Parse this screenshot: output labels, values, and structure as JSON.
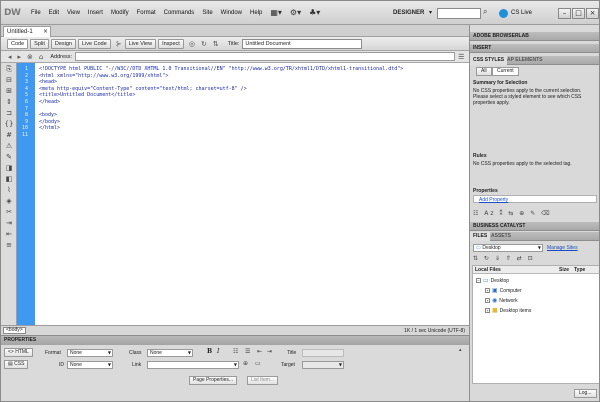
{
  "app": {
    "logo": "DW",
    "workspace": "DESIGNER",
    "cs_live": "CS Live"
  },
  "menu": [
    "File",
    "Edit",
    "View",
    "Insert",
    "Modify",
    "Format",
    "Commands",
    "Site",
    "Window",
    "Help"
  ],
  "document": {
    "tab_name": "Untitled-1",
    "view_buttons": {
      "code": "Code",
      "split": "Split",
      "design": "Design",
      "live_code": "Live Code",
      "live_view": "Live View",
      "inspect": "Inspect"
    },
    "title_label": "Title:",
    "title_value": "Untitled Document",
    "address_label": "Address:"
  },
  "code": {
    "line_numbers": [
      "1",
      "2",
      "3",
      "4",
      "5",
      "6",
      "7",
      "8",
      "9",
      "10",
      "11"
    ],
    "lines": [
      "<!DOCTYPE html PUBLIC \"-//W3C//DTD XHTML 1.0 Transitional//EN\" \"http://www.w3.org/TR/xhtml1/DTD/xhtml1-transitional.dtd\">",
      "<html xmlns=\"http://www.w3.org/1999/xhtml\">",
      "<head>",
      "<meta http-equiv=\"Content-Type\" content=\"text/html; charset=utf-8\" />",
      "<title>Untitled Document</title>",
      "</head>",
      "",
      "<body>",
      "</body>",
      "</html>",
      ""
    ]
  },
  "status": {
    "tag_selector": "<body>",
    "info": "1K / 1 sec  Unicode (UTF-8)"
  },
  "properties": {
    "header": "PROPERTIES",
    "html_button": "HTML",
    "css_button": "CSS",
    "format_label": "Format",
    "format_value": "None",
    "class_label": "Class",
    "class_value": "None",
    "id_label": "ID",
    "id_value": "None",
    "link_label": "Link",
    "title_label": "Title",
    "target_label": "Target",
    "page_properties_button": "Page Properties...",
    "list_item_button": "List Item..."
  },
  "right_panels": {
    "browserlab": "ADOBE BROWSERLAB",
    "insert": "INSERT",
    "css_styles_tab": "CSS STYLES",
    "ap_elements_tab": "AP ELEMENTS",
    "all_button": "All",
    "current_button": "Current",
    "summary_title": "Summary for Selection",
    "summary_text": [
      "No CSS properties apply to the current selection.",
      "Please select a styled element to see which CSS",
      "properties apply."
    ],
    "rules_title": "Rules",
    "rules_text": "No CSS properties apply to the selected tag.",
    "properties_title": "Properties",
    "add_property": "Add Property",
    "business_catalyst": "BUSINESS CATALYST",
    "files_tab": "FILES",
    "assets_tab": "ASSETS",
    "site_select": "Desktop",
    "manage_sites": "Manage Sites",
    "files_columns": {
      "local": "Local Files",
      "size": "Size",
      "type": "Type"
    },
    "tree": [
      {
        "label": "Desktop",
        "level": 0
      },
      {
        "label": "Computer",
        "level": 1
      },
      {
        "label": "Network",
        "level": 1
      },
      {
        "label": "Desktop items",
        "level": 1
      }
    ],
    "log_button": "Log..."
  }
}
